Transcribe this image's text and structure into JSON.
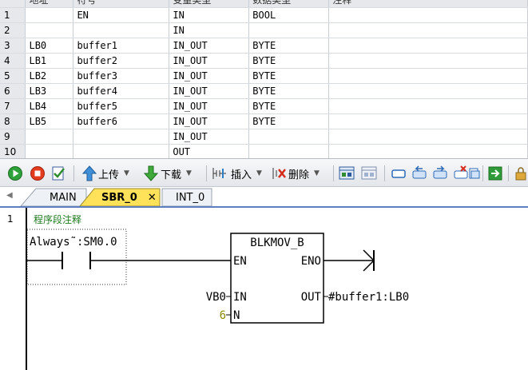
{
  "var_table": {
    "headers": [
      "",
      "地址",
      "符号",
      "变量类型",
      "数据类型",
      "注释"
    ],
    "rows": [
      {
        "num": "1",
        "addr": "",
        "sym": "EN",
        "vtype": "IN",
        "dtype": "BOOL"
      },
      {
        "num": "2",
        "addr": "",
        "sym": "",
        "vtype": "IN",
        "dtype": ""
      },
      {
        "num": "3",
        "addr": "LB0",
        "sym": "buffer1",
        "vtype": "IN_OUT",
        "dtype": "BYTE"
      },
      {
        "num": "4",
        "addr": "LB1",
        "sym": "buffer2",
        "vtype": "IN_OUT",
        "dtype": "BYTE"
      },
      {
        "num": "5",
        "addr": "LB2",
        "sym": "buffer3",
        "vtype": "IN_OUT",
        "dtype": "BYTE"
      },
      {
        "num": "6",
        "addr": "LB3",
        "sym": "buffer4",
        "vtype": "IN_OUT",
        "dtype": "BYTE"
      },
      {
        "num": "7",
        "addr": "LB4",
        "sym": "buffer5",
        "vtype": "IN_OUT",
        "dtype": "BYTE"
      },
      {
        "num": "8",
        "addr": "LB5",
        "sym": "buffer6",
        "vtype": "IN_OUT",
        "dtype": "BYTE"
      },
      {
        "num": "9",
        "addr": "",
        "sym": "",
        "vtype": "IN_OUT",
        "dtype": ""
      },
      {
        "num": "10",
        "addr": "",
        "sym": "",
        "vtype": "OUT",
        "dtype": ""
      }
    ]
  },
  "toolbar": {
    "upload_label": "上传",
    "download_label": "下载",
    "insert_label": "插入",
    "delete_label": "删除"
  },
  "tabs": [
    "MAIN",
    "SBR_0",
    "INT_0"
  ],
  "active_tab": "SBR_0",
  "editor": {
    "network_number": "1",
    "network_comment": "程序段注释",
    "contact_label": "Always˜:SM0.0",
    "block": {
      "name": "BLKMOV_B",
      "en": "EN",
      "eno": "ENO",
      "in": "IN",
      "out": "OUT",
      "n": "N",
      "in_operand": "VB0",
      "out_operand": "#buffer1:LB0",
      "n_operand": "6"
    }
  },
  "colors": {
    "accent": "#5e7ec2",
    "active_tab": "#ffe15a",
    "comment_green": "#1f7a1f",
    "constant_olive": "#8a8a00"
  }
}
